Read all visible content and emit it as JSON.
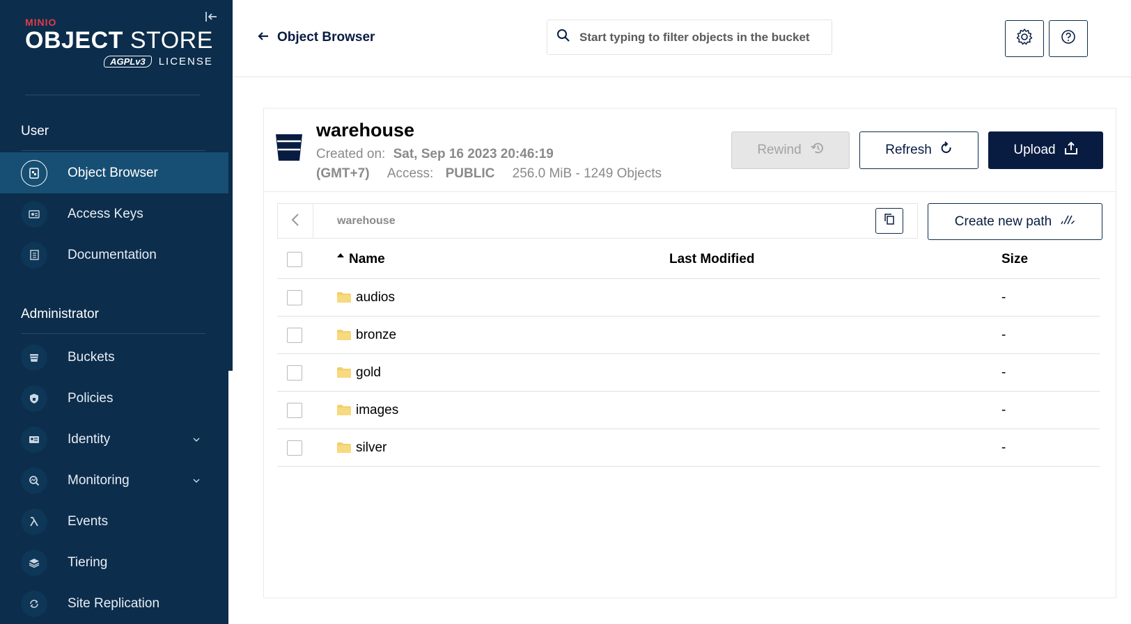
{
  "brand": {
    "minio": "MINIO",
    "object": "OBJECT",
    "store": " STORE",
    "agpl": "AGPLv3",
    "license": "LICENSE"
  },
  "sidebar": {
    "user_section": "User",
    "admin_section": "Administrator",
    "user_items": [
      {
        "label": "Object Browser",
        "icon": "object-browser-icon",
        "active": true
      },
      {
        "label": "Access Keys",
        "icon": "access-keys-icon"
      },
      {
        "label": "Documentation",
        "icon": "documentation-icon"
      }
    ],
    "admin_items": [
      {
        "label": "Buckets",
        "icon": "buckets-icon"
      },
      {
        "label": "Policies",
        "icon": "policies-icon"
      },
      {
        "label": "Identity",
        "icon": "identity-icon",
        "expandable": true
      },
      {
        "label": "Monitoring",
        "icon": "monitoring-icon",
        "expandable": true
      },
      {
        "label": "Events",
        "icon": "lambda-icon"
      },
      {
        "label": "Tiering",
        "icon": "tiering-icon"
      },
      {
        "label": "Site Replication",
        "icon": "site-replication-icon"
      }
    ]
  },
  "header": {
    "back_label": "Object Browser",
    "search_placeholder": "Start typing to filter objects in the bucket"
  },
  "bucket": {
    "name": "warehouse",
    "created_label": "Created on:",
    "created_value": "Sat, Sep 16 2023 20:46:19",
    "timezone": "(GMT+7)",
    "access_label": "Access:",
    "access_value": "PUBLIC",
    "usage": "256.0 MiB - 1249 Objects"
  },
  "actions": {
    "rewind": "Rewind",
    "refresh": "Refresh",
    "upload": "Upload",
    "create_path": "Create new path"
  },
  "path": {
    "current": "warehouse"
  },
  "table": {
    "columns": {
      "name": "Name",
      "modified": "Last Modified",
      "size": "Size"
    },
    "rows": [
      {
        "name": "audios",
        "modified": "",
        "size": "-"
      },
      {
        "name": "bronze",
        "modified": "",
        "size": "-"
      },
      {
        "name": "gold",
        "modified": "",
        "size": "-"
      },
      {
        "name": "images",
        "modified": "",
        "size": "-"
      },
      {
        "name": "silver",
        "modified": "",
        "size": "-"
      }
    ]
  },
  "colors": {
    "sidebar_bg": "#0c2d4b",
    "active_item": "#174e73",
    "primary": "#081c42",
    "brand_red": "#e23b4a",
    "folder": "#f3cf6a"
  }
}
